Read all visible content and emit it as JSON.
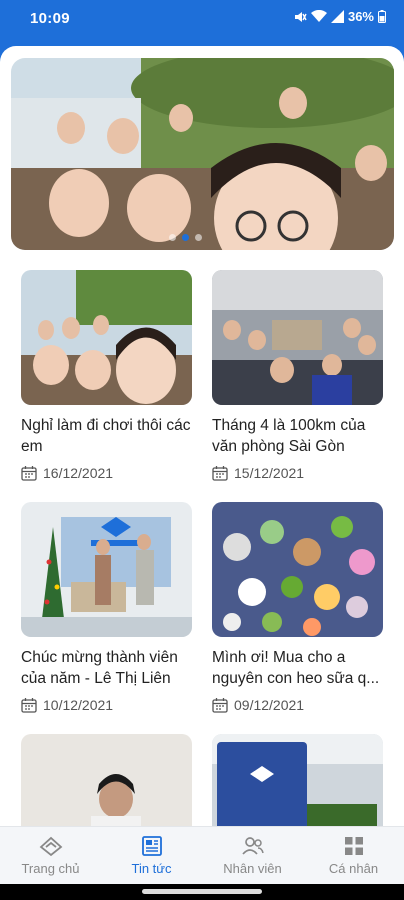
{
  "status_bar": {
    "time": "10:09",
    "battery": "36%"
  },
  "banner": {
    "dots": 3,
    "active_dot": 1
  },
  "news": [
    {
      "title": "Nghỉ làm đi chơi thôi các em",
      "date": "16/12/2021"
    },
    {
      "title": "Tháng 4 là 100km của văn phòng Sài Gòn",
      "date": "15/12/2021"
    },
    {
      "title": "Chúc mừng thành viên của năm - Lê Thị Liên",
      "date": "10/12/2021"
    },
    {
      "title": "Mình ơi! Mua cho a nguyên con heo sữa q...",
      "date": "09/12/2021"
    }
  ],
  "bottom_nav": [
    {
      "label": "Trang chủ",
      "icon": "home-icon"
    },
    {
      "label": "Tin tức",
      "icon": "news-icon"
    },
    {
      "label": "Nhân viên",
      "icon": "people-icon"
    },
    {
      "label": "Cá nhân",
      "icon": "grid-icon"
    }
  ],
  "colors": {
    "primary": "#1e6fd9",
    "inactive": "#888888"
  }
}
